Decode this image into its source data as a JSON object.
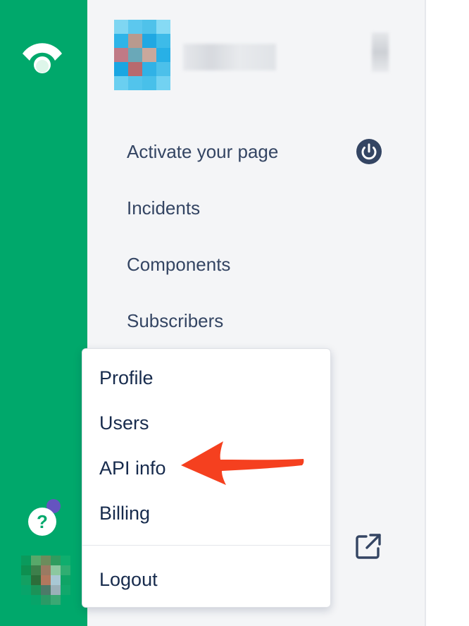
{
  "sidebar": {
    "brand_color": "#00a86b",
    "logo_icon": "statuspage-logo-icon",
    "help_icon": "help-icon",
    "help_label": "?",
    "notification_dot_color": "#6554c0"
  },
  "nav": {
    "items": [
      {
        "label": "Activate your page",
        "icon": "power-icon"
      },
      {
        "label": "Incidents"
      },
      {
        "label": "Components"
      },
      {
        "label": "Subscribers"
      }
    ],
    "external_icon": "external-link-icon"
  },
  "account_menu": {
    "items": [
      {
        "label": "Profile"
      },
      {
        "label": "Users"
      },
      {
        "label": "API info"
      },
      {
        "label": "Billing"
      }
    ],
    "logout_label": "Logout",
    "highlight_arrow_color": "#f5401f"
  }
}
